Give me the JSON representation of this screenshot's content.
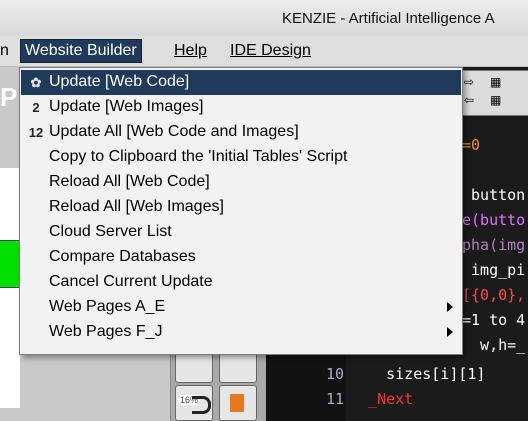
{
  "window": {
    "title": "KENZIE - Artificial Intelligence A"
  },
  "menubar": {
    "items": [
      {
        "label": "n"
      },
      {
        "label": "Website Builder"
      },
      {
        "label": "Help"
      },
      {
        "label": "IDE Design"
      }
    ]
  },
  "dropdown": {
    "items": [
      {
        "label": "Update [Web Code]",
        "icon": "gear-icon",
        "highlighted": true
      },
      {
        "label": "Update [Web Images]",
        "icon": "image-update-icon",
        "badge": "2"
      },
      {
        "label": "Update All [Web Code and Images]",
        "badge": "12"
      },
      {
        "label": "Copy to Clipboard the 'Initial Tables' Script"
      },
      {
        "label": "Reload All [Web Code]"
      },
      {
        "label": "Reload All [Web Images]"
      },
      {
        "label": "Cloud Server List"
      },
      {
        "label": "Compare Databases"
      },
      {
        "label": "Cancel Current Update"
      },
      {
        "label": "Web Pages A_E",
        "submenu": true
      },
      {
        "label": "Web Pages F_J",
        "submenu": true
      }
    ]
  },
  "background": {
    "left_char": "P",
    "code_visible": [
      {
        "num": "",
        "text": "=0"
      },
      {
        "num": "",
        "text": " button"
      },
      {
        "num": "",
        "text": "e(butto"
      },
      {
        "num": "",
        "text": "pha(img"
      },
      {
        "num": "",
        "text": " img_pi"
      },
      {
        "num": "",
        "text": "[{0,0},"
      },
      {
        "num": "",
        "text": "=1 to 4"
      },
      {
        "num": "",
        "text": "  w,h=_"
      },
      {
        "num": "10",
        "text": "    sizes[i][1]"
      },
      {
        "num": "11",
        "text": "  _Next"
      }
    ],
    "tool_badge": "16%"
  },
  "colors": {
    "highlight": "#1f3a5a",
    "green": "#00e000",
    "code_bg": "#1b1b1b"
  }
}
